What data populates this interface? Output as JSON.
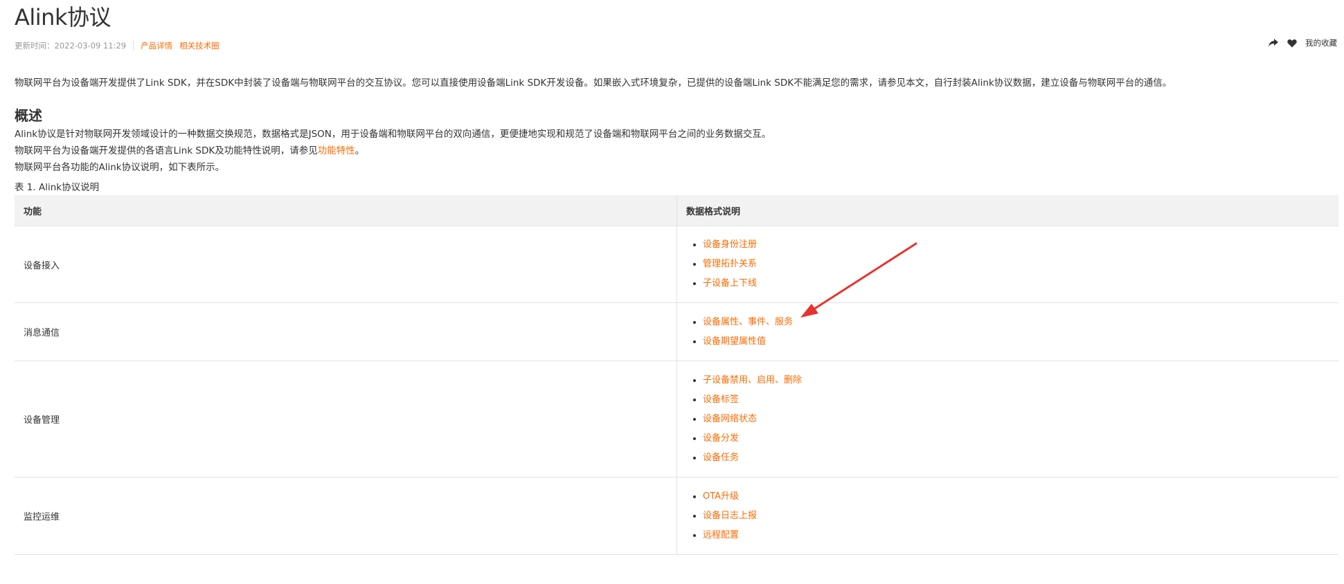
{
  "header": {
    "title": "Alink协议",
    "updated": "更新时间：2022-03-09 11:29",
    "links": [
      "产品详情",
      "相关技术圈"
    ],
    "favorites_label": "我的收藏",
    "share_icon": "share-icon",
    "favorite_icon": "heart-icon"
  },
  "intro": "物联网平台为设备端开发提供了Link SDK，并在SDK中封装了设备端与物联网平台的交互协议。您可以直接使用设备端Link SDK开发设备。如果嵌入式环境复杂，已提供的设备端Link SDK不能满足您的需求，请参见本文，自行封装Alink协议数据，建立设备与物联网平台的通信。",
  "overview": {
    "heading": "概述",
    "para1": "Alink协议是针对物联网开发领域设计的一种数据交换规范，数据格式是JSON，用于设备端和物联网平台的双向通信，更便捷地实现和规范了设备端和物联网平台之间的业务数据交互。",
    "para2_prefix": "物联网平台为设备端开发提供的各语言Link SDK及功能特性说明，请参见",
    "para2_link": "功能特性",
    "para2_suffix": "。",
    "para3": "物联网平台各功能的Alink协议说明，如下表所示。"
  },
  "table": {
    "caption": "表 1. Alink协议说明",
    "headers": [
      "功能",
      "数据格式说明"
    ],
    "rows": [
      {
        "feature": "设备接入",
        "links": [
          "设备身份注册",
          "管理拓扑关系",
          "子设备上下线"
        ]
      },
      {
        "feature": "消息通信",
        "links": [
          "设备属性、事件、服务",
          "设备期望属性值"
        ]
      },
      {
        "feature": "设备管理",
        "links": [
          "子设备禁用、启用、删除",
          "设备标签",
          "设备网络状态",
          "设备分发",
          "设备任务"
        ]
      },
      {
        "feature": "监控运维",
        "links": [
          "OTA升级",
          "设备日志上报",
          "远程配置"
        ]
      }
    ]
  },
  "colors": {
    "link": "#ff6a00",
    "annotation_arrow": "#e8322d"
  }
}
